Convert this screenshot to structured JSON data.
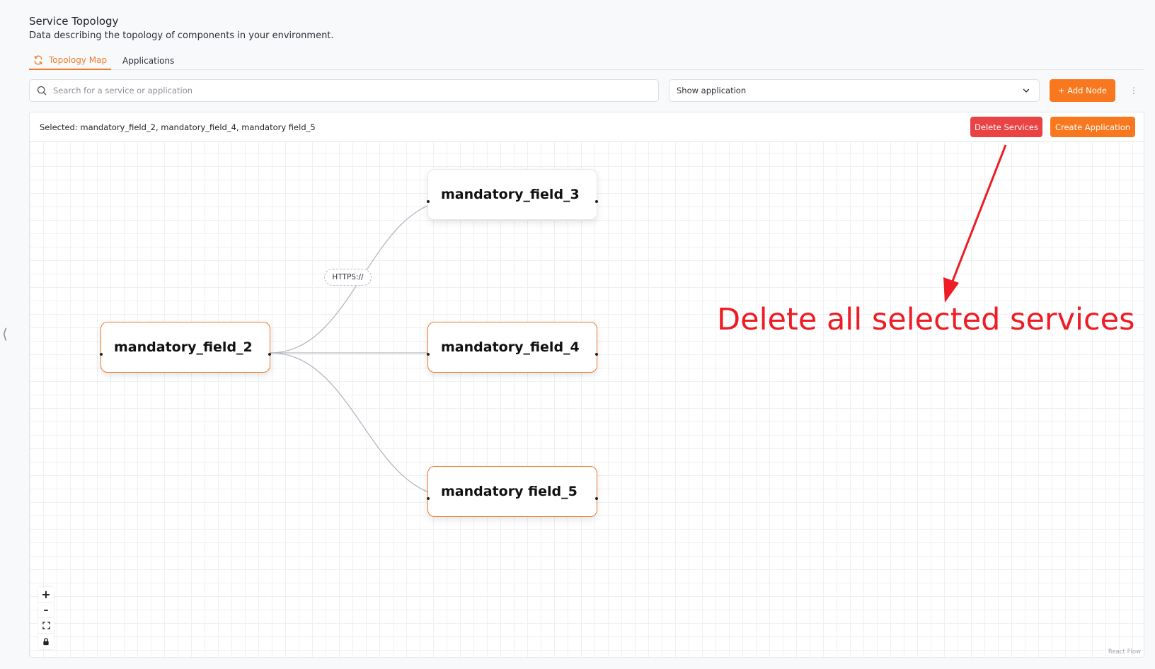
{
  "header": {
    "title": "Service Topology",
    "subtitle": "Data describing the topology of components in your environment."
  },
  "tabs": [
    {
      "label": "Topology Map",
      "active": true,
      "icon": "refresh-icon"
    },
    {
      "label": "Applications",
      "active": false
    }
  ],
  "toolbar": {
    "search_placeholder": "Search for a service or application",
    "search_value": "",
    "select_value": "Show application",
    "add_node_label": "+ Add Node",
    "more_icon": "vertical-dots-icon"
  },
  "selection": {
    "text": "Selected: mandatory_field_2, mandatory_field_4, mandatory field_5",
    "delete_label": "Delete Services",
    "create_label": "Create Application"
  },
  "nodes": [
    {
      "id": "n2",
      "label": "mandatory_field_2",
      "selected": true
    },
    {
      "id": "n3",
      "label": "mandatory_field_3",
      "selected": false
    },
    {
      "id": "n4",
      "label": "mandatory_field_4",
      "selected": true
    },
    {
      "id": "n5",
      "label": "mandatory field_5",
      "selected": true
    }
  ],
  "edges": [
    {
      "from": "mandatory_field_2",
      "to": "mandatory_field_3",
      "label": "HTTPS://"
    },
    {
      "from": "mandatory_field_2",
      "to": "mandatory_field_4",
      "label": ""
    },
    {
      "from": "mandatory_field_2",
      "to": "mandatory field_5",
      "label": ""
    }
  ],
  "controls": {
    "zoom_in": "+",
    "zoom_out": "–",
    "fit_icon": "fit-view-icon",
    "lock_icon": "lock-icon",
    "attribution": "React Flow"
  },
  "annotation": {
    "text": "Delete all selected services",
    "color": "#ee1c25"
  },
  "colors": {
    "accent": "#f7781f",
    "danger": "#e94343",
    "selected_border": "#f07b2c"
  }
}
